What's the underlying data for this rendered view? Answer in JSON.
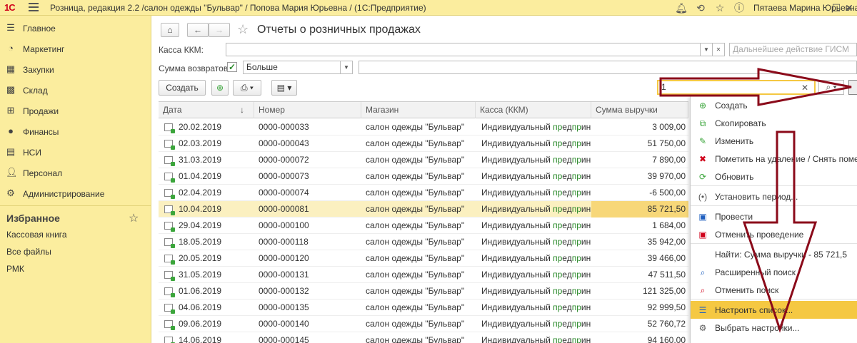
{
  "titlebar": {
    "logo": "1С",
    "title": "Розница, редакция 2.2 /салон одежды \"Бульвар\" / Попова Мария Юрьевна / (1С:Предприятие)",
    "user": "Пятаева Марина Юрьевна",
    "icons": [
      "menu-icon",
      "bell-icon",
      "history-icon",
      "star-icon",
      "info-icon",
      "window-icon",
      "close-icon"
    ]
  },
  "sidebar": {
    "items": [
      {
        "label": "Главное",
        "icon": "menu-icon"
      },
      {
        "label": "Маркетинг",
        "icon": "pie-chart-icon"
      },
      {
        "label": "Закупки",
        "icon": "truck-icon"
      },
      {
        "label": "Склад",
        "icon": "warehouse-icon"
      },
      {
        "label": "Продажи",
        "icon": "cart-icon"
      },
      {
        "label": "Финансы",
        "icon": "coin-icon"
      },
      {
        "label": "НСИ",
        "icon": "catalog-icon"
      },
      {
        "label": "Персонал",
        "icon": "person-icon"
      },
      {
        "label": "Администрирование",
        "icon": "gear-icon"
      }
    ],
    "favorites_title": "Избранное",
    "favorites": [
      "Кассовая книга",
      "Все файлы",
      "РМК"
    ]
  },
  "form": {
    "title": "Отчеты о розничных продажах",
    "kassa_label": "Касса ККМ:",
    "kassa_value": "",
    "gism_placeholder": "Дальнейшее действие ГИСМ",
    "returns_label": "Сумма возвратов:",
    "returns_checked": true,
    "returns_condition": "Больше",
    "returns_value": "",
    "create_label": "Создать",
    "search_value": "1"
  },
  "table": {
    "columns": [
      "Дата",
      "Номер",
      "Магазин",
      "Касса (ККМ)",
      "Сумма выручки"
    ],
    "sort_column": "Дата",
    "selected_index": 5,
    "rows": [
      {
        "date": "20.02.2019",
        "number": "0000-000033",
        "shop": "салон одежды \"Бульвар\"",
        "kassa_pre": "Индивидуальный ",
        "kassa_hl": "пр",
        "kassa_mid": "ед",
        "kassa_hl2": "пр",
        "kassa_post": "ин...",
        "sum": "3 009,00"
      },
      {
        "date": "02.03.2019",
        "number": "0000-000043",
        "shop": "салон одежды \"Бульвар\"",
        "kassa_pre": "Индивидуальный ",
        "kassa_hl": "пр",
        "kassa_mid": "ед",
        "kassa_hl2": "пр",
        "kassa_post": "ин...",
        "sum": "51 750,00"
      },
      {
        "date": "31.03.2019",
        "number": "0000-000072",
        "shop": "салон одежды \"Бульвар\"",
        "kassa_pre": "Индивидуальный ",
        "kassa_hl": "пр",
        "kassa_mid": "ед",
        "kassa_hl2": "пр",
        "kassa_post": "ин...",
        "sum": "7 890,00"
      },
      {
        "date": "01.04.2019",
        "number": "0000-000073",
        "shop": "салон одежды \"Бульвар\"",
        "kassa_pre": "Индивидуальный ",
        "kassa_hl": "пр",
        "kassa_mid": "ед",
        "kassa_hl2": "пр",
        "kassa_post": "ин...",
        "sum": "39 970,00"
      },
      {
        "date": "02.04.2019",
        "number": "0000-000074",
        "shop": "салон одежды \"Бульвар\"",
        "kassa_pre": "Индивидуальный ",
        "kassa_hl": "пр",
        "kassa_mid": "ед",
        "kassa_hl2": "пр",
        "kassa_post": "ин...",
        "sum": "-6 500,00"
      },
      {
        "date": "10.04.2019",
        "number": "0000-000081",
        "shop": "салон одежды \"Бульвар\"",
        "kassa_pre": "Индивидуальный ",
        "kassa_hl": "пр",
        "kassa_mid": "ед",
        "kassa_hl2": "пр",
        "kassa_post": "ин...",
        "sum": "85 721,50"
      },
      {
        "date": "29.04.2019",
        "number": "0000-000100",
        "shop": "салон одежды \"Бульвар\"",
        "kassa_pre": "Индивидуальный ",
        "kassa_hl": "пр",
        "kassa_mid": "ед",
        "kassa_hl2": "пр",
        "kassa_post": "ин...",
        "sum": "1 684,00"
      },
      {
        "date": "18.05.2019",
        "number": "0000-000118",
        "shop": "салон одежды \"Бульвар\"",
        "kassa_pre": "Индивидуальный ",
        "kassa_hl": "пр",
        "kassa_mid": "ед",
        "kassa_hl2": "пр",
        "kassa_post": "ин...",
        "sum": "35 942,00"
      },
      {
        "date": "20.05.2019",
        "number": "0000-000120",
        "shop": "салон одежды \"Бульвар\"",
        "kassa_pre": "Индивидуальный ",
        "kassa_hl": "пр",
        "kassa_mid": "ед",
        "kassa_hl2": "пр",
        "kassa_post": "ин...",
        "sum": "39 466,00"
      },
      {
        "date": "31.05.2019",
        "number": "0000-000131",
        "shop": "салон одежды \"Бульвар\"",
        "kassa_pre": "Индивидуальный ",
        "kassa_hl": "пр",
        "kassa_mid": "ед",
        "kassa_hl2": "пр",
        "kassa_post": "ин...",
        "sum": "47 511,50"
      },
      {
        "date": "01.06.2019",
        "number": "0000-000132",
        "shop": "салон одежды \"Бульвар\"",
        "kassa_pre": "Индивидуальный ",
        "kassa_hl": "пр",
        "kassa_mid": "ед",
        "kassa_hl2": "пр",
        "kassa_post": "ин...",
        "sum": "121 325,00"
      },
      {
        "date": "04.06.2019",
        "number": "0000-000135",
        "shop": "салон одежды \"Бульвар\"",
        "kassa_pre": "Индивидуальный ",
        "kassa_hl": "пр",
        "kassa_mid": "ед",
        "kassa_hl2": "пр",
        "kassa_post": "ин...",
        "sum": "92 999,50"
      },
      {
        "date": "09.06.2019",
        "number": "0000-000140",
        "shop": "салон одежды \"Бульвар\"",
        "kassa_pre": "Индивидуальный ",
        "kassa_hl": "пр",
        "kassa_mid": "ед",
        "kassa_hl2": "пр",
        "kassa_post": "ин...",
        "sum": "52 760,72"
      },
      {
        "date": "14.06.2019",
        "number": "0000-000145",
        "shop": "салон одежды \"Бульвар\"",
        "kassa_pre": "Индивидуальный ",
        "kassa_hl": "пр",
        "kassa_mid": "ед",
        "kassa_hl2": "пр",
        "kassa_post": "ин...",
        "sum": "94 160,00"
      }
    ]
  },
  "menu": {
    "items": [
      {
        "label": "Создать",
        "icon": "plus-circle-icon",
        "icon_color": "#3ba53b",
        "glyph": "⊕"
      },
      {
        "label": "Скопировать",
        "icon": "copy-icon",
        "icon_color": "#3ba53b",
        "glyph": "⧉"
      },
      {
        "label": "Изменить",
        "icon": "pencil-icon",
        "icon_color": "#3ba53b",
        "glyph": "✎"
      },
      {
        "label": "Пометить на удаление / Снять пометку",
        "icon": "delete-mark-icon",
        "icon_color": "#d0021b",
        "glyph": "✖"
      },
      {
        "label": "Обновить",
        "icon": "refresh-icon",
        "icon_color": "#3ba53b",
        "glyph": "⟳"
      },
      {
        "label": "Установить период...",
        "icon": "period-icon",
        "icon_color": "#555555",
        "glyph": "(•)"
      },
      {
        "label": "Провести",
        "icon": "post-icon",
        "icon_color": "#1f5fbf",
        "glyph": "▣"
      },
      {
        "label": "Отменить проведение",
        "icon": "unpost-icon",
        "icon_color": "#d0021b",
        "glyph": "▣"
      },
      {
        "label": "Найти: Сумма выручки - 85 721,5",
        "icon": "",
        "icon_color": "#555555",
        "glyph": ""
      },
      {
        "label": "Расширенный поиск",
        "icon": "advanced-search-icon",
        "icon_color": "#1f5fbf",
        "glyph": "⌕"
      },
      {
        "label": "Отменить поиск",
        "icon": "cancel-search-icon",
        "icon_color": "#d0021b",
        "glyph": "⌕"
      },
      {
        "label": "Настроить список...",
        "icon": "list-settings-icon",
        "icon_color": "#1f5fbf",
        "glyph": "☰"
      },
      {
        "label": "Выбрать настройки...",
        "icon": "choose-settings-icon",
        "icon_color": "#555555",
        "glyph": "⚙"
      }
    ],
    "hover_index": 11
  },
  "colors": {
    "panel_yellow": "#fbed9e",
    "selected_row": "#fbf0c0",
    "menu_highlight": "#f5c842",
    "annotation_arrow": "#8b0a1a"
  }
}
